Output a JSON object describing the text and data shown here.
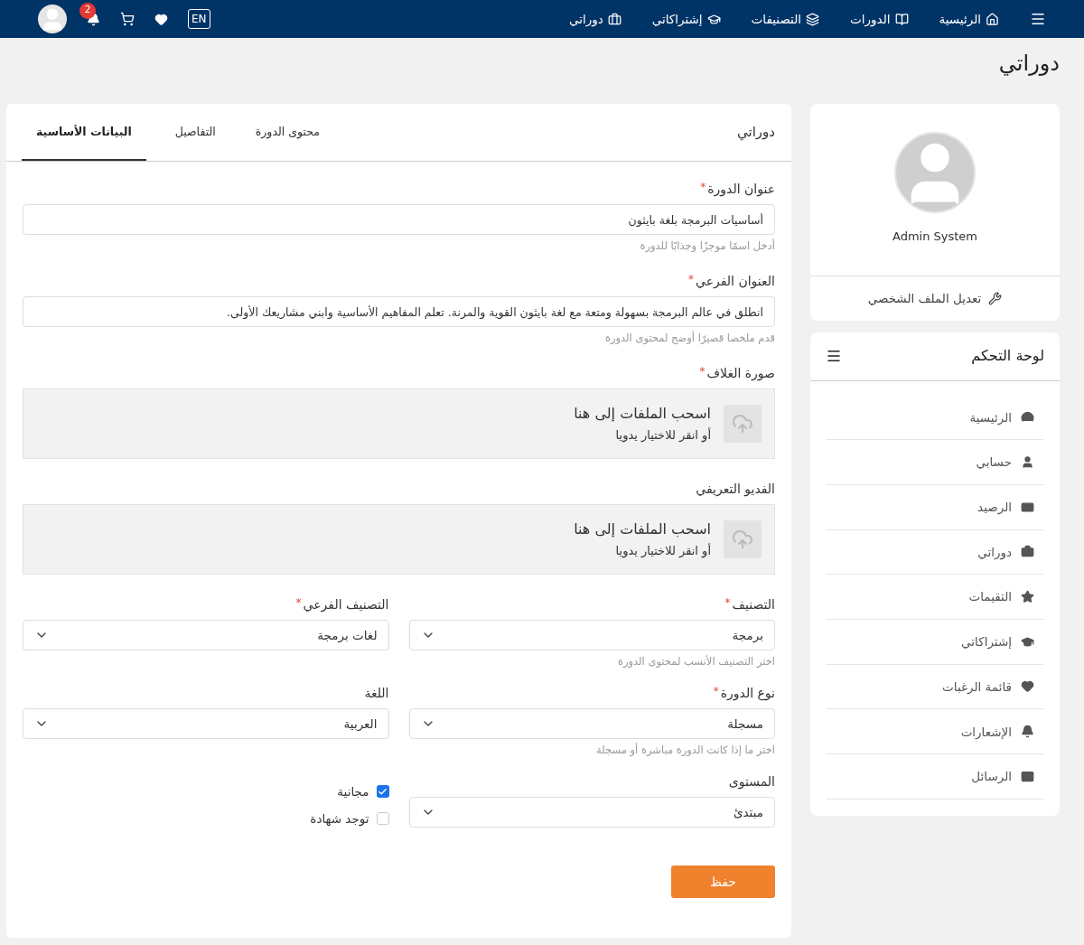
{
  "navbar": {
    "items": [
      {
        "label": "الرئيسية"
      },
      {
        "label": "الدورات"
      },
      {
        "label": "التصنيفات"
      },
      {
        "label": "إشتراكاتي"
      },
      {
        "label": "دوراتي"
      }
    ],
    "language": "EN",
    "notifications_count": "2"
  },
  "page_title": "دوراتي",
  "profile": {
    "name": "Admin System",
    "edit_link": "تعديل الملف الشخصي"
  },
  "dashboard": {
    "title": "لوحة التحكم",
    "items": [
      {
        "label": "الرئيسية"
      },
      {
        "label": "حسابي"
      },
      {
        "label": "الرصيد"
      },
      {
        "label": "دوراتي"
      },
      {
        "label": "التقيمات"
      },
      {
        "label": "إشتراكاتي"
      },
      {
        "label": "قائمة الرغبات"
      },
      {
        "label": "الإشعارات"
      },
      {
        "label": "الرسائل"
      }
    ]
  },
  "form_card": {
    "title": "دوراتي",
    "tabs": [
      {
        "label": "محتوى الدورة",
        "selected": false
      },
      {
        "label": "التفاصيل",
        "selected": false
      },
      {
        "label": "البيانات الأساسية",
        "selected": true
      }
    ],
    "fields": [
      {
        "kind": "text",
        "label": "عنوان الدورة",
        "required_mark": "*",
        "value": "أساسيات البرمجة بلغة بايثون",
        "hint": "أدخل اسمًا موجزًا وجذابًا للدورة"
      },
      {
        "kind": "text",
        "label": "العنوان الفرعي",
        "required_mark": "*",
        "value": "انطلق في عالم البرمجة بسهولة ومتعة مع لغة بايثون القوية والمرنة. تعلم المفاهيم الأساسية وابني مشاريعك الأولى.",
        "hint": "قدم ملخصا قصيرًا أوضح لمحتوى الدورة"
      },
      {
        "kind": "upload",
        "label": "صورة الغلاف",
        "required_mark": "*",
        "drop_title": "اسحب الملفات إلى هنا",
        "drop_hint": "أو انقر للاختيار يدويا"
      },
      {
        "kind": "upload",
        "label": "الفديو التعريفي",
        "drop_title": "اسحب الملفات إلى هنا",
        "drop_hint": "أو انقر للاختيار يدويا"
      },
      {
        "kind": "select",
        "label": "التصنيف",
        "required_mark": "*",
        "value": "برمجة",
        "hint": "اختر التصنيف الأنسب لمحتوى الدورة"
      },
      {
        "kind": "select",
        "label": "التصنيف الفرعي",
        "required_mark": "*",
        "value": "لغات برمجة"
      },
      {
        "kind": "select",
        "label": "نوع الدورة",
        "required_mark": "*",
        "value": "مسجلة",
        "hint": "اختر ما إذا كانت الدورة مباشرة أو مسجلة"
      },
      {
        "kind": "select",
        "label": "اللغة",
        "value": "العربية"
      },
      {
        "kind": "select",
        "label": "المستوى",
        "value": "مبتدئ"
      },
      {
        "kind": "checks",
        "options": [
          {
            "label": "مجانية",
            "checked": true
          },
          {
            "label": "توجد شهادة",
            "checked": false
          }
        ]
      }
    ],
    "save_button": "حفظ"
  }
}
